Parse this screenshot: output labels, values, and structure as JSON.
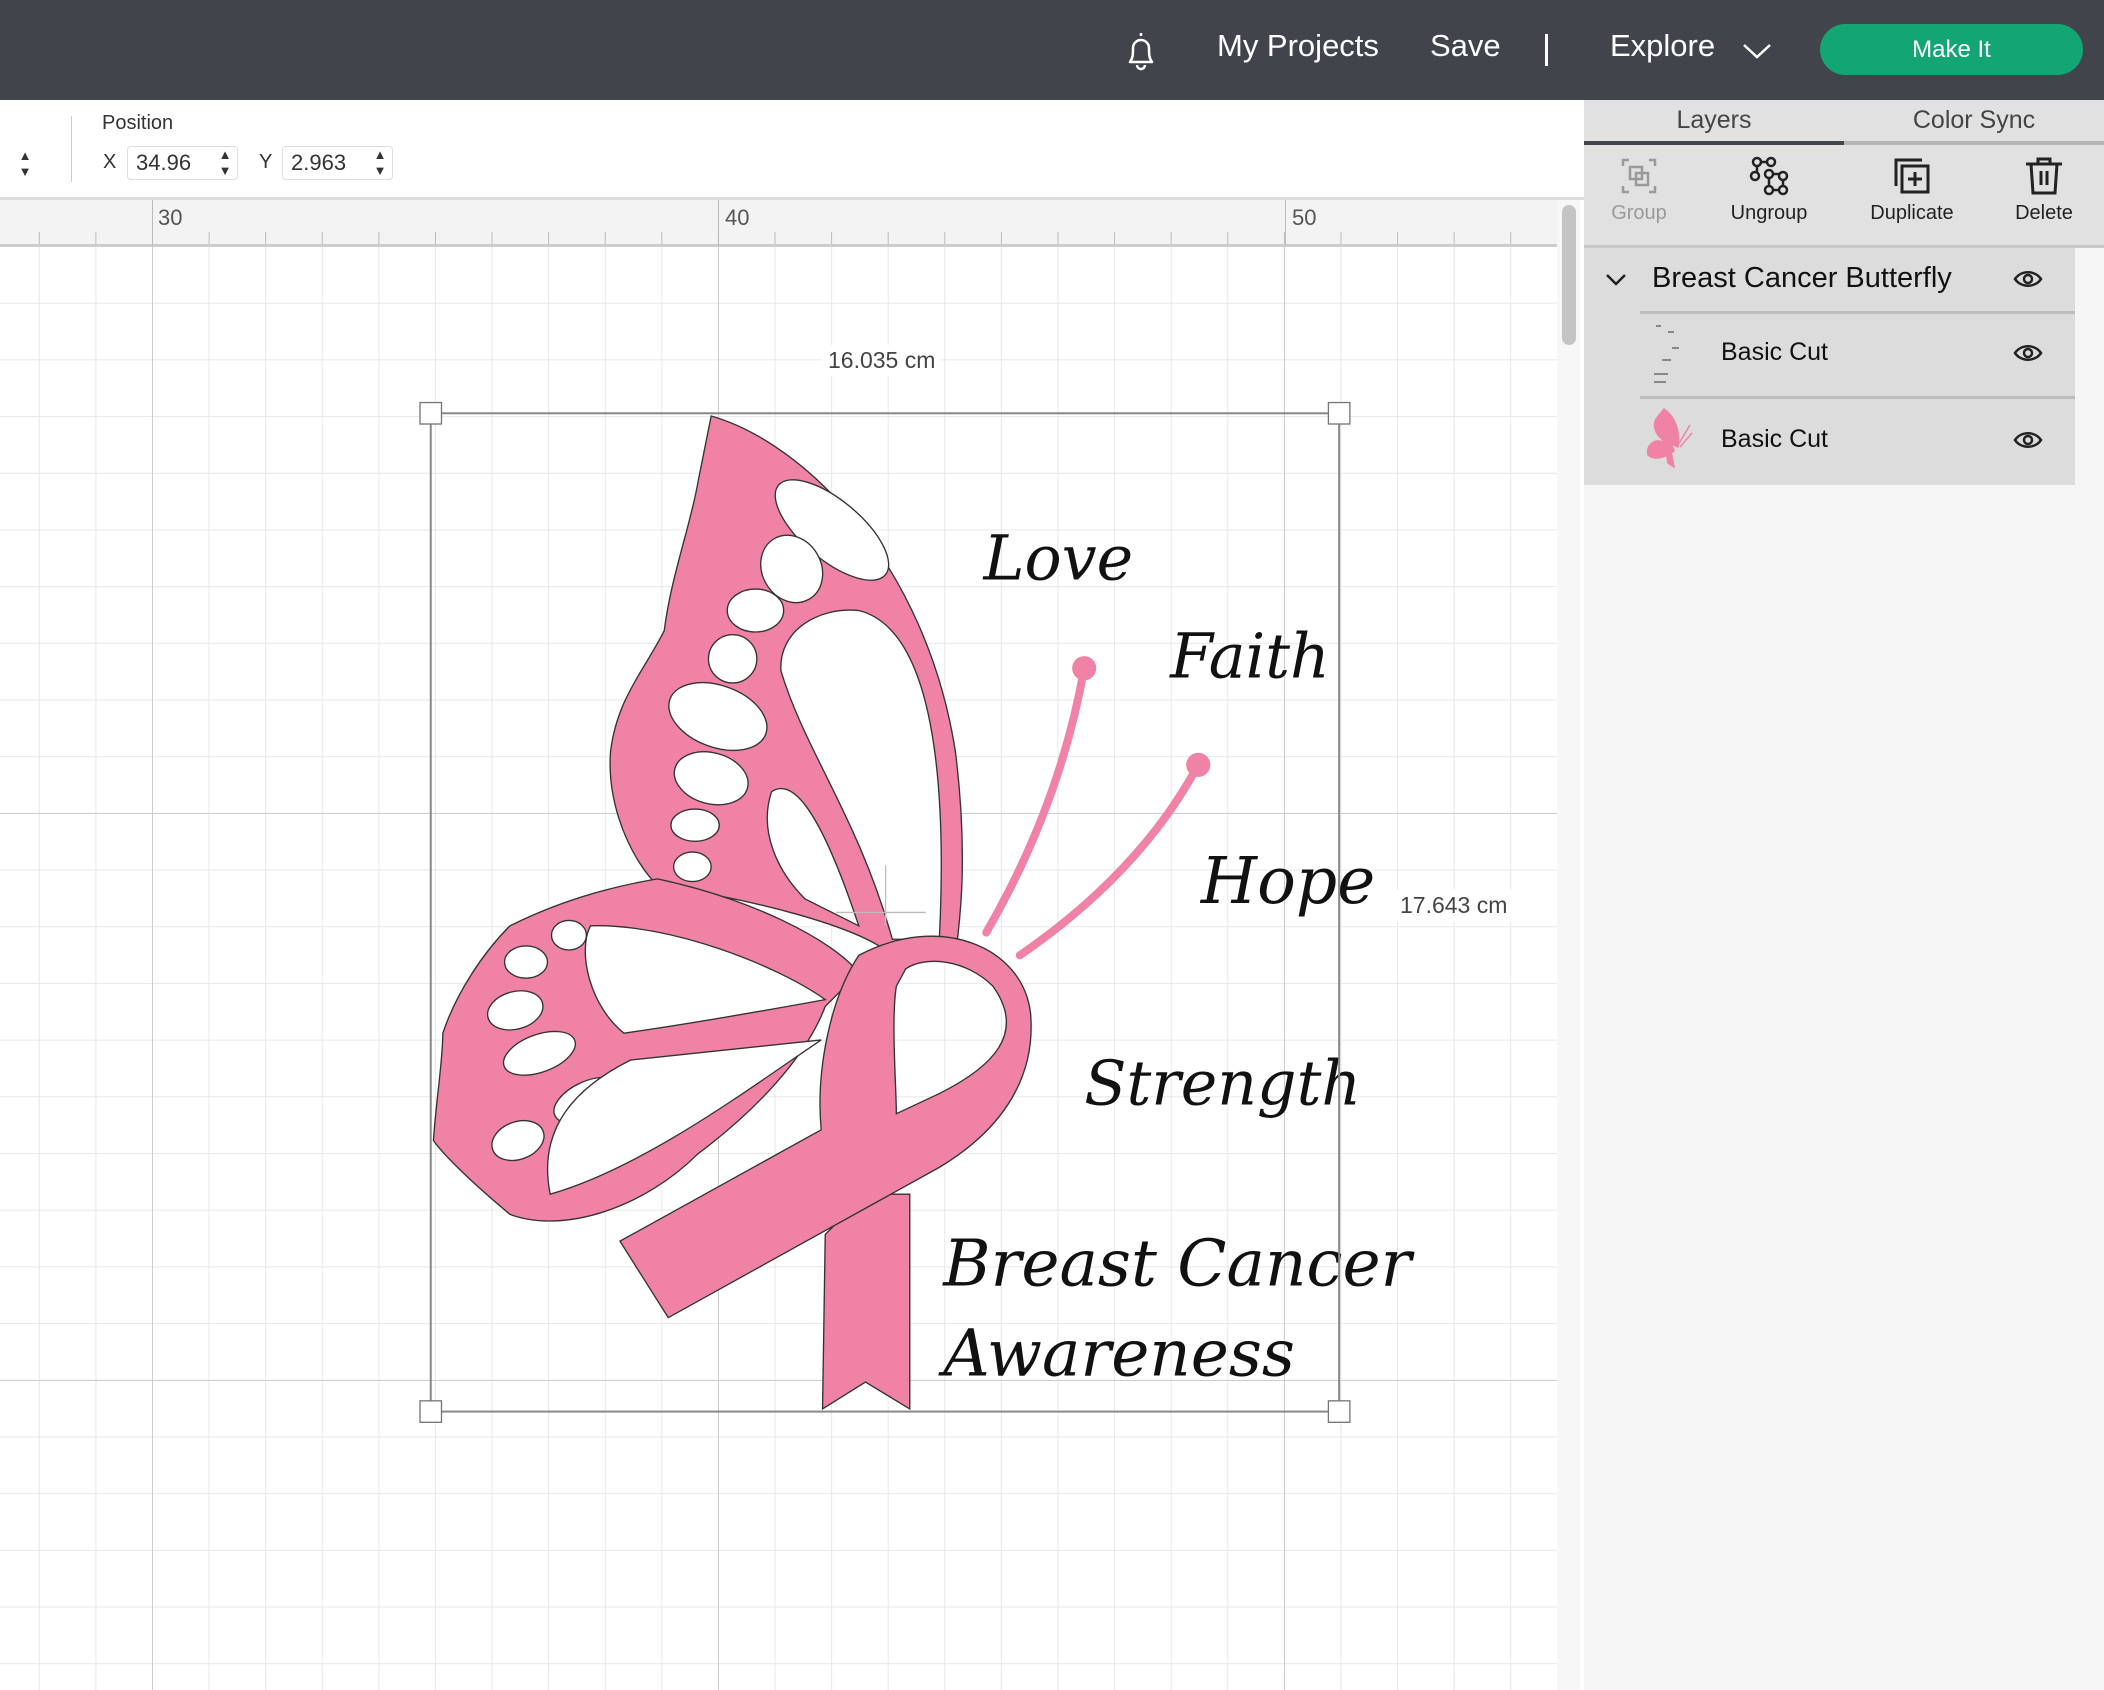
{
  "topbar": {
    "notifications_icon": "bell-icon",
    "my_projects": "My Projects",
    "save": "Save",
    "divider": "|",
    "explore": "Explore",
    "make_it": "Make It",
    "accent": "#13A574"
  },
  "toolbar": {
    "position_label": "Position",
    "x_label": "X",
    "x_value": "34.96",
    "y_label": "Y",
    "y_value": "2.963"
  },
  "ruler": {
    "labels": [
      "30",
      "40",
      "50"
    ]
  },
  "canvas": {
    "width_label": "16.035 cm",
    "height_label": "17.643 cm",
    "artwork": {
      "fill_color": "#F082A5",
      "words": [
        "Love",
        "Faith",
        "Hope",
        "Strength",
        "Breast Cancer",
        "Awareness"
      ]
    }
  },
  "panel": {
    "tabs": [
      {
        "label": "Layers",
        "active": true
      },
      {
        "label": "Color Sync",
        "active": false
      }
    ],
    "tools": [
      {
        "label": "Group",
        "icon": "group-icon",
        "enabled": false
      },
      {
        "label": "Ungroup",
        "icon": "ungroup-icon",
        "enabled": true
      },
      {
        "label": "Duplicate",
        "icon": "duplicate-icon",
        "enabled": true
      },
      {
        "label": "Delete",
        "icon": "trash-icon",
        "enabled": true
      }
    ],
    "group": {
      "name": "Breast Cancer Butterfly",
      "expanded": true,
      "visible": true
    },
    "layers": [
      {
        "name": "Basic Cut",
        "thumbnail": "text-words",
        "visible": true
      },
      {
        "name": "Basic Cut",
        "thumbnail": "pink-butterfly",
        "visible": true
      }
    ]
  }
}
